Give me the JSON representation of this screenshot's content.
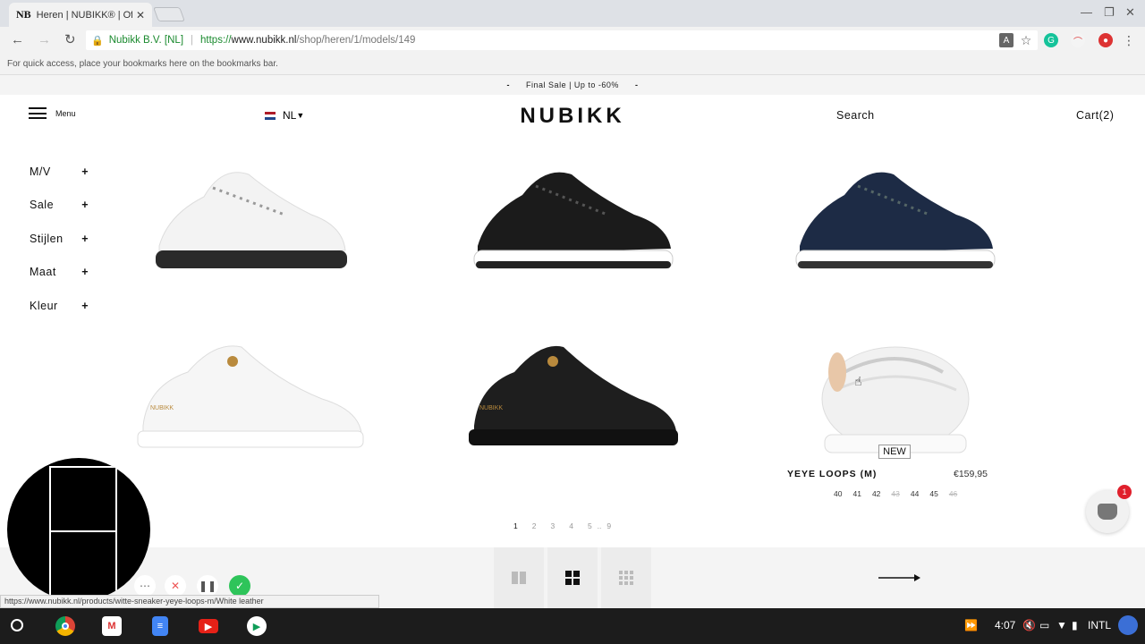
{
  "browser": {
    "tab_title": "Heren | NUBIKK® | Offici",
    "tab_favicon": "NB",
    "org_name": "Nubikk B.V. [NL]",
    "url_scheme": "https://",
    "url_host": "www.nubikk.nl",
    "url_path": "/shop/heren/1/models/149",
    "bookmarks_hint": "For quick access, place your bookmarks here on the bookmarks bar.",
    "status_url": "https://www.nubikk.nl/products/witte-sneaker-yeye-loops-m/White leather"
  },
  "site": {
    "promo": "Final Sale | Up to -60%",
    "promo_dash": "-",
    "menu_label": "Menu",
    "lang": "NL",
    "logo": "NUBIKK",
    "search": "Search",
    "cart": "Cart(2)"
  },
  "filters": [
    {
      "label": "M/V",
      "plus": "+"
    },
    {
      "label": "Sale",
      "plus": "+"
    },
    {
      "label": "Stijlen",
      "plus": "+"
    },
    {
      "label": "Maat",
      "plus": "+"
    },
    {
      "label": "Kleur",
      "plus": "+"
    }
  ],
  "product": {
    "badge": "NEW",
    "name": "YEYE LOOPS (M)",
    "price": "€159,95",
    "sizes": [
      "40",
      "41",
      "42",
      "43",
      "44",
      "45",
      "46"
    ]
  },
  "pagination": [
    "1",
    "2",
    "3",
    "4",
    "5",
    "..",
    "9"
  ],
  "chat_count": "1",
  "brand_mark": "NUBIKK",
  "colors": {
    "accent_green": "#1a8a2e",
    "badge_red": "#e0202c"
  },
  "taskbar": {
    "clock": "4:07",
    "ime": "INTL"
  }
}
